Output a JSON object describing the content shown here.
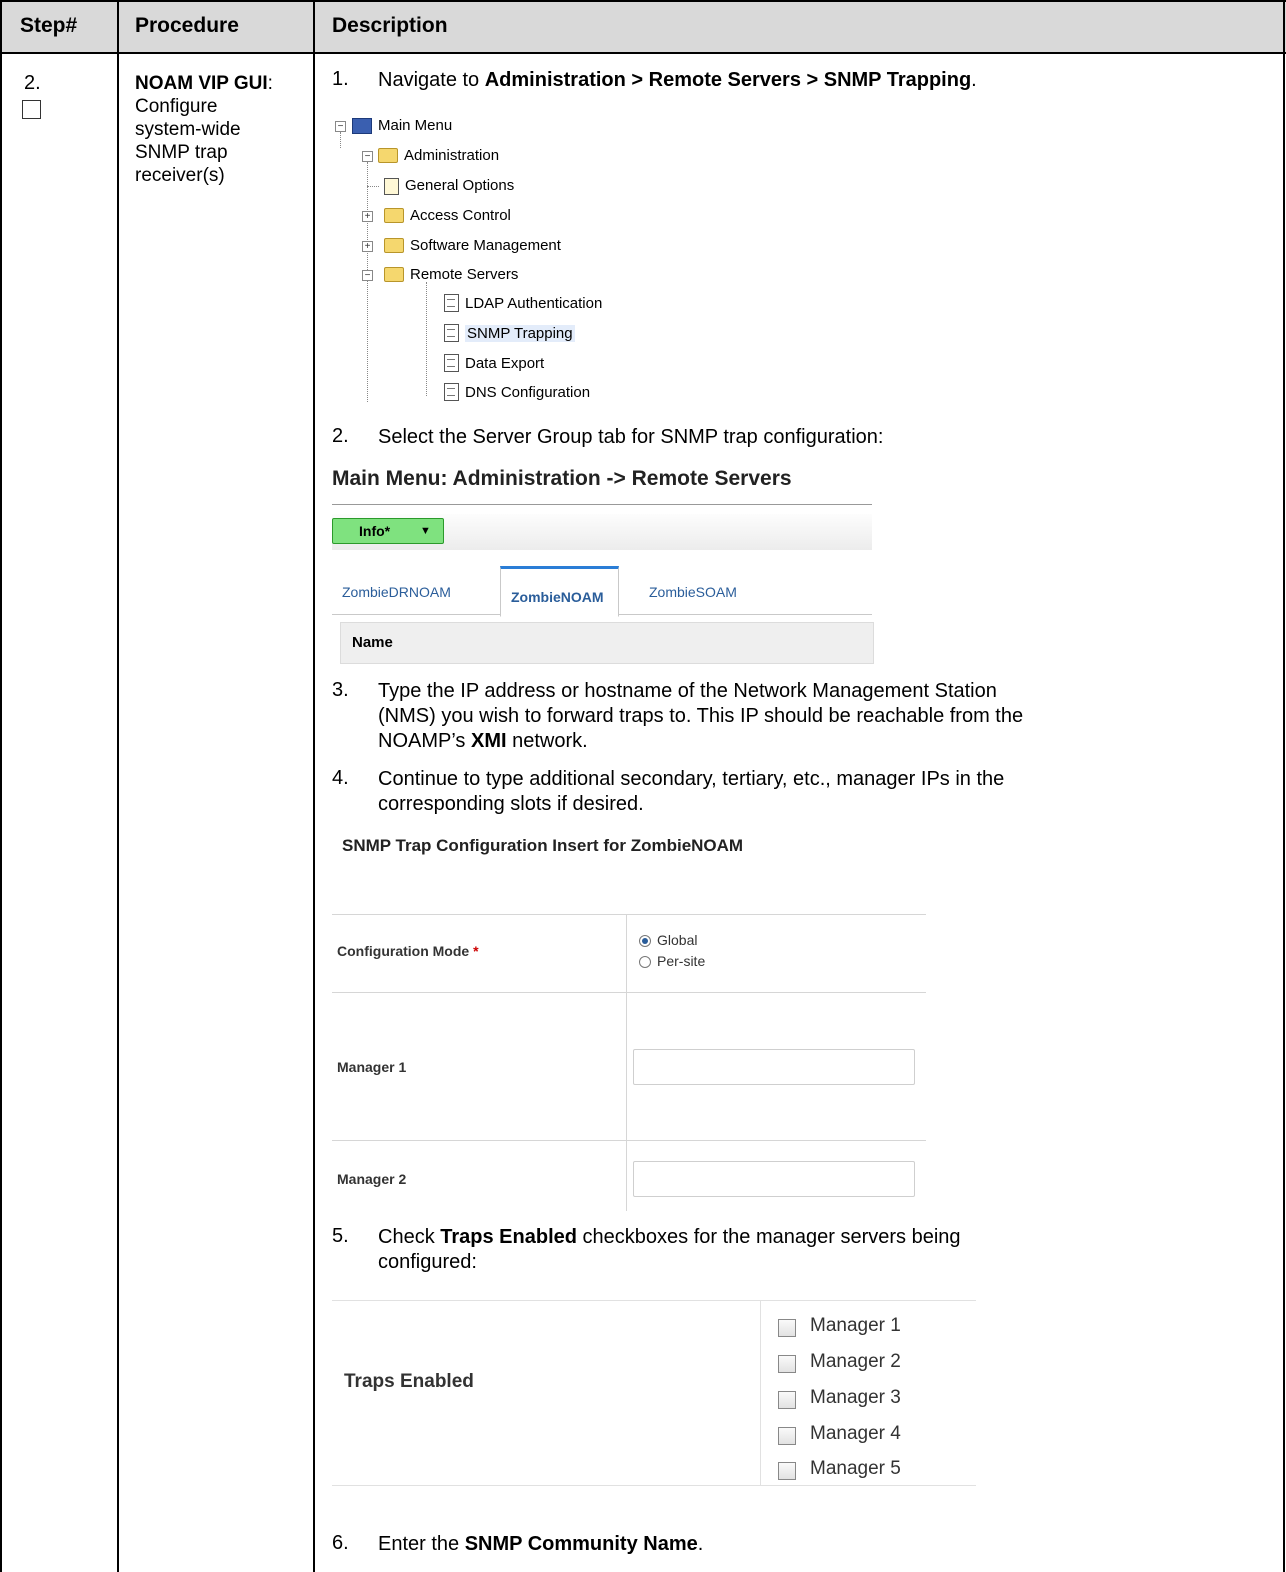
{
  "table_header": {
    "step": "Step#",
    "procedure": "Procedure",
    "description": "Description"
  },
  "step": {
    "number": "2.",
    "procedure_bold": "NOAM VIP GUI",
    "procedure_text": "Configure system-wide SNMP trap receiver(s)"
  },
  "items": {
    "n1": "1.",
    "i1_pre": "Navigate to ",
    "i1_bold": "Administration > Remote Servers > SNMP Trapping",
    "i1_post": ".",
    "n2": "2.",
    "i2": "Select the Server Group tab for SNMP trap configuration:",
    "n3": "3.",
    "i3_l1": "Type the IP address or hostname of the Network Management Station",
    "i3_l2": "(NMS) you wish to forward traps to.  This IP should be reachable from the",
    "i3_l3_pre": "NOAMP’s ",
    "i3_l3_bold": "XMI",
    "i3_l3_post": " network.",
    "n4": "4.",
    "i4_l1": "Continue to type additional secondary, tertiary, etc., manager IPs in the",
    "i4_l2": "corresponding slots if desired.",
    "n5": "5.",
    "i5_pre": "Check ",
    "i5_bold": "Traps Enabled",
    "i5_post": " checkboxes for the manager servers being",
    "i5_l2": "configured:",
    "n6": "6.",
    "i6_pre": "Enter the ",
    "i6_bold": "SNMP Community Name",
    "i6_post": "."
  },
  "menu_tree": {
    "root": "Main Menu",
    "administration": "Administration",
    "general_options": "General Options",
    "access_control": "Access Control",
    "software_management": "Software Management",
    "remote_servers": "Remote Servers",
    "ldap": "LDAP Authentication",
    "snmp": "SNMP Trapping",
    "data_export": "Data Export",
    "dns": "DNS Configuration"
  },
  "server_group_screen": {
    "title": "Main Menu: Administration -> Remote Servers",
    "info_button": "Info*",
    "tabs": [
      "ZombieDRNOAM",
      "ZombieNOAM",
      "ZombieSOAM"
    ],
    "active_tab": "ZombieNOAM",
    "column_header": "Name"
  },
  "insert_screen": {
    "title": "SNMP Trap Configuration Insert for ZombieNOAM",
    "config_mode_label": "Configuration Mode",
    "required_mark": "*",
    "mode_options": [
      "Global",
      "Per-site"
    ],
    "selected_mode": "Global",
    "manager1_label": "Manager 1",
    "manager1_value": "",
    "manager2_label": "Manager 2",
    "manager2_value": ""
  },
  "traps_screen": {
    "label": "Traps Enabled",
    "managers": [
      "Manager 1",
      "Manager 2",
      "Manager 3",
      "Manager 4",
      "Manager 5"
    ],
    "checked": [
      false,
      false,
      false,
      false,
      false
    ]
  }
}
